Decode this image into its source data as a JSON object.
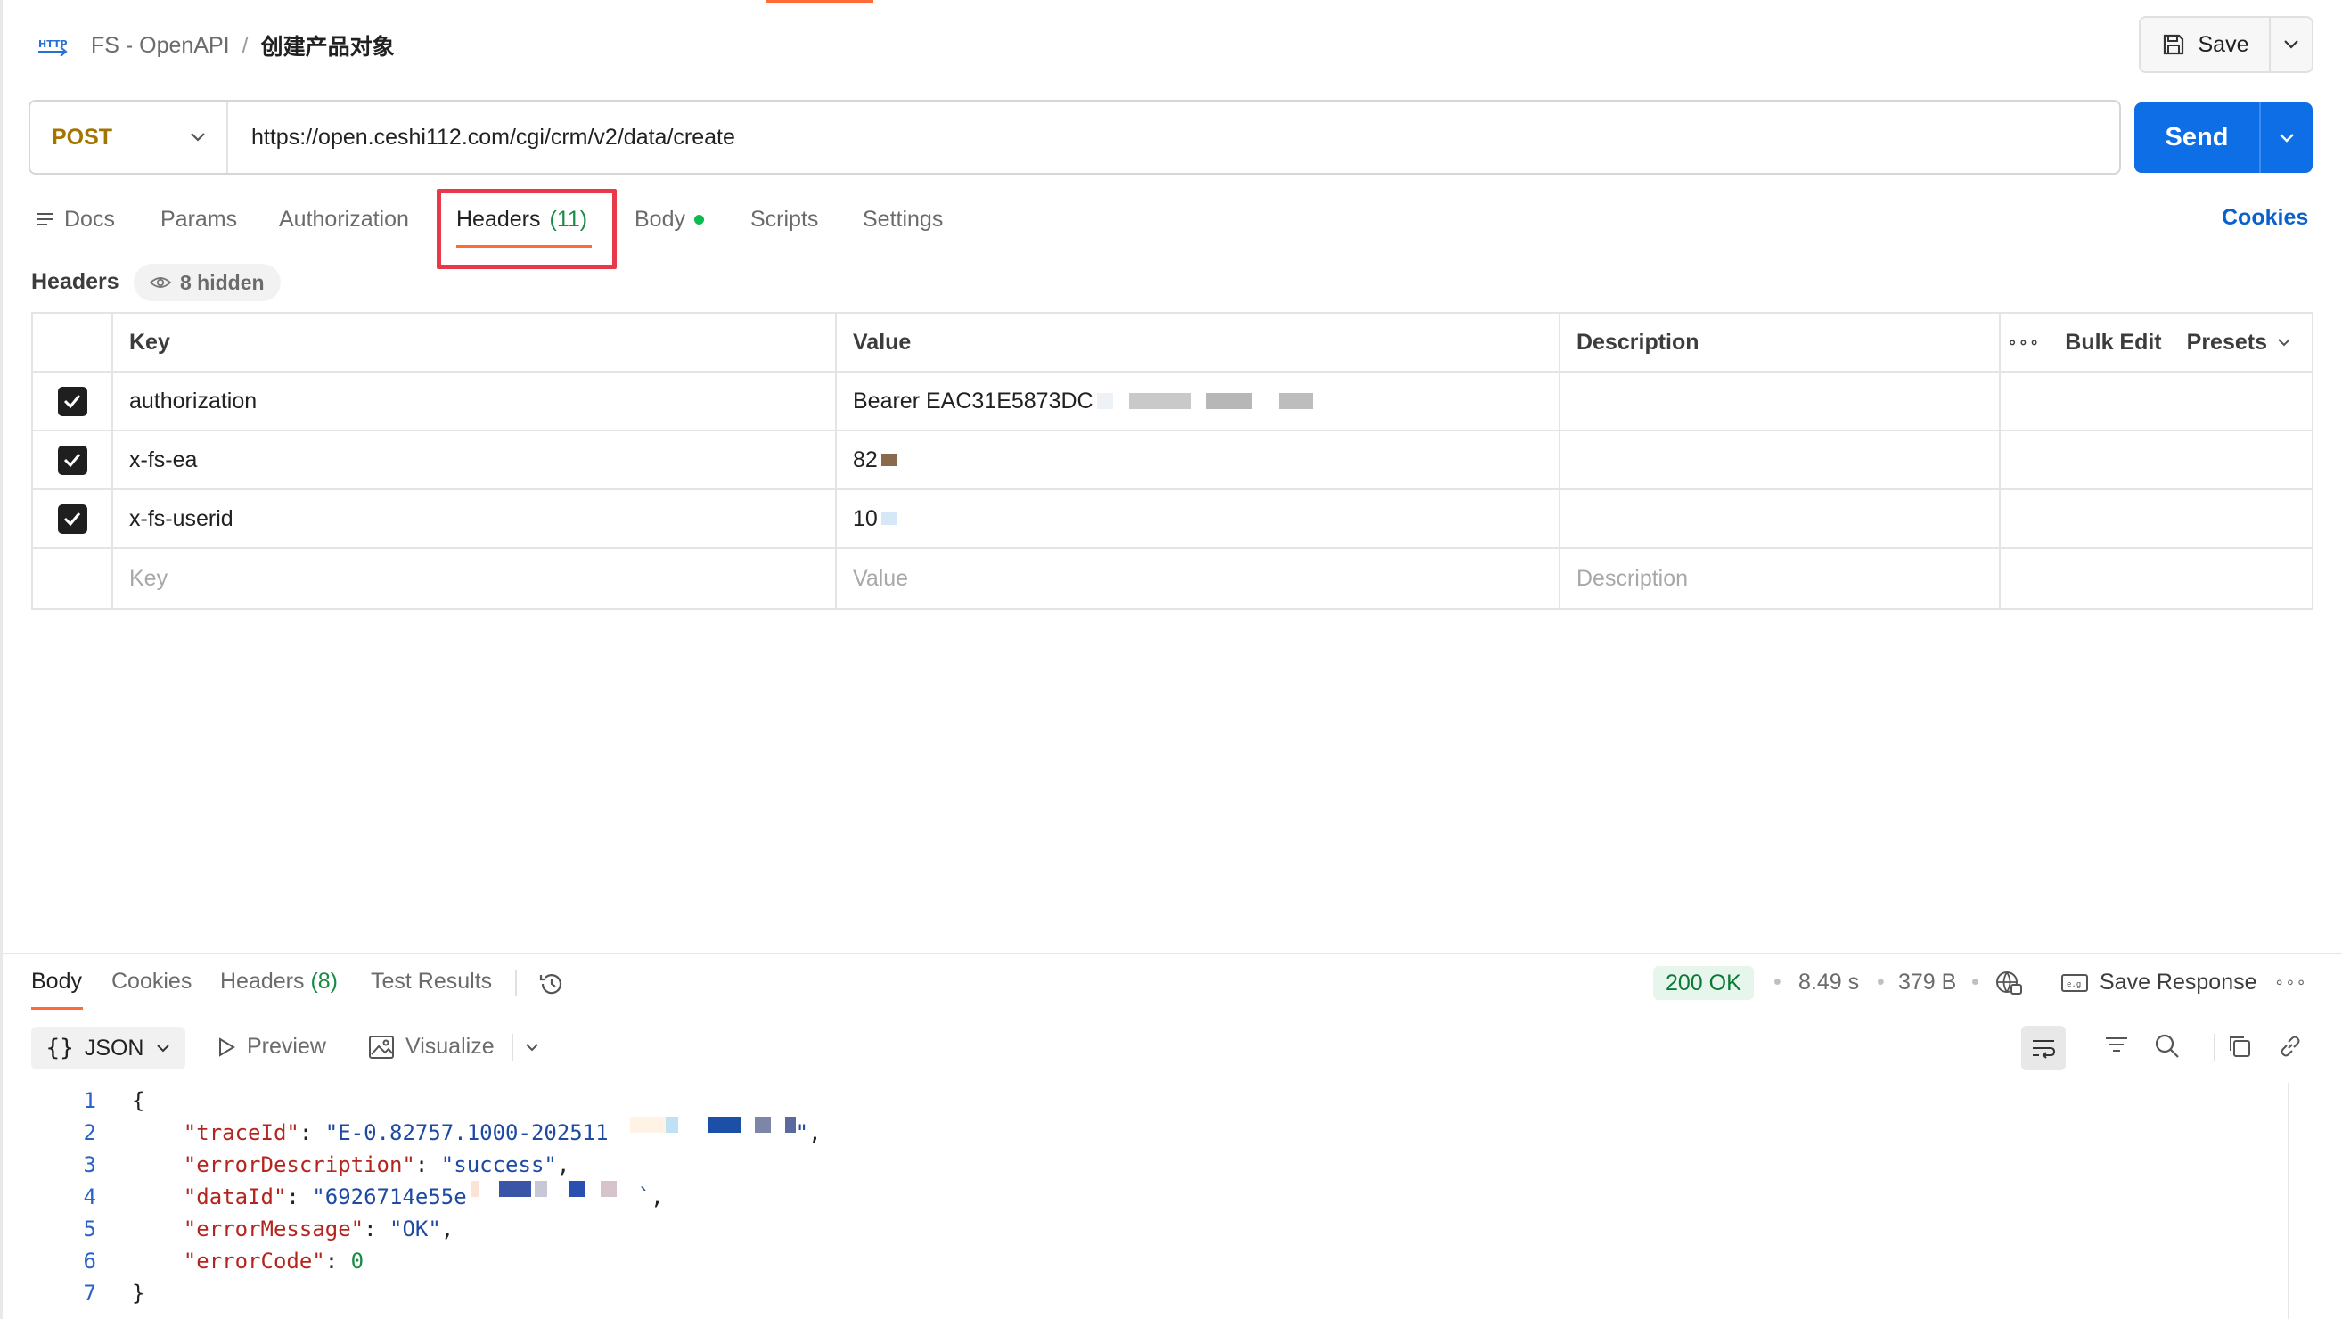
{
  "breadcrumb": {
    "protocol_badge": "HTTP",
    "collection": "FS - OpenAPI",
    "separator": "/",
    "request_name": "创建产品对象"
  },
  "save": {
    "label": "Save"
  },
  "request": {
    "method": "POST",
    "url": "https://open.ceshi112.com/cgi/crm/v2/data/create",
    "send_label": "Send"
  },
  "tabs": {
    "docs": "Docs",
    "params": "Params",
    "authorization": "Authorization",
    "headers": "Headers",
    "headers_count": "(11)",
    "body": "Body",
    "scripts": "Scripts",
    "settings": "Settings",
    "active": "Headers"
  },
  "cookies_link": "Cookies",
  "headers_section": {
    "title": "Headers",
    "hidden_label": "8 hidden",
    "columns": {
      "key": "Key",
      "value": "Value",
      "description": "Description"
    },
    "actions": {
      "bulk_edit": "Bulk Edit",
      "presets": "Presets"
    },
    "rows": [
      {
        "key": "authorization",
        "value": "Bearer EAC31E5873DC",
        "checked": true
      },
      {
        "key": "x-fs-ea",
        "value": "82",
        "checked": true
      },
      {
        "key": "x-fs-userid",
        "value": "10",
        "checked": true
      }
    ],
    "placeholders": {
      "key": "Key",
      "value": "Value",
      "description": "Description"
    }
  },
  "response": {
    "tabs": {
      "body": "Body",
      "cookies": "Cookies",
      "headers": "Headers",
      "headers_count": "(8)",
      "test_results": "Test Results"
    },
    "status": "200 OK",
    "time": "8.49 s",
    "size": "379 B",
    "save_response": "Save Response",
    "format": "JSON",
    "preview": "Preview",
    "visualize": "Visualize",
    "code_lines": [
      {
        "num": "1"
      },
      {
        "num": "2",
        "key": "\"traceId\"",
        "value": "\"E-0.82757.1000-202511"
      },
      {
        "num": "3",
        "key": "\"errorDescription\"",
        "value": "\"success\""
      },
      {
        "num": "4",
        "key": "\"dataId\"",
        "value": "\"6926714e55e"
      },
      {
        "num": "5",
        "key": "\"errorMessage\"",
        "value": "\"OK\""
      },
      {
        "num": "6",
        "key": "\"errorCode\"",
        "value": "0"
      },
      {
        "num": "7"
      }
    ]
  },
  "colors": {
    "accent": "#ff6c37",
    "send": "#0d6ee6",
    "method_post": "#a37400",
    "highlight_box": "#e8394a",
    "status_ok": "#0b7a36"
  }
}
